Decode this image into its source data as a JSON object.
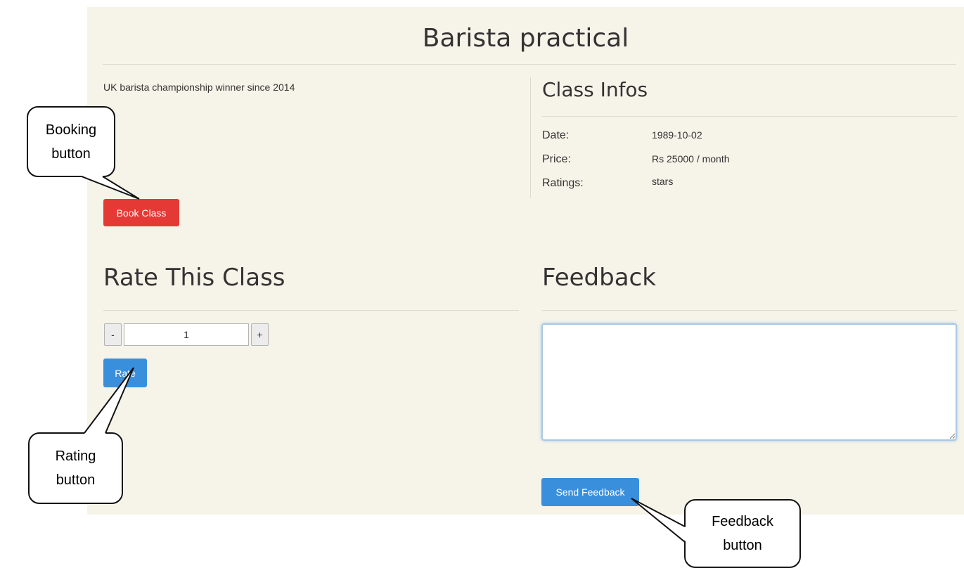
{
  "page": {
    "title": "Barista practical",
    "description": "UK barista championship winner since 2014"
  },
  "class_infos": {
    "heading": "Class Infos",
    "rows": [
      {
        "label": "Date:",
        "value": "1989-10-02"
      },
      {
        "label": "Price:",
        "value": "Rs 25000 / month"
      },
      {
        "label": "Ratings:",
        "value": "stars"
      }
    ]
  },
  "booking": {
    "button_label": "Book Class"
  },
  "rating": {
    "heading": "Rate This Class",
    "decrement_label": "-",
    "value": "1",
    "increment_label": "+",
    "button_label": "Rate"
  },
  "feedback": {
    "heading": "Feedback",
    "text_value": "",
    "button_label": "Send Feedback"
  },
  "callouts": {
    "booking": [
      "Booking",
      "button"
    ],
    "rating": [
      "Rating",
      "button"
    ],
    "feedback": [
      "Feedback",
      "button"
    ]
  },
  "colors": {
    "panel_background": "#f6f3e8",
    "book_button": "#e53935",
    "primary_button": "#3a8fdc"
  }
}
